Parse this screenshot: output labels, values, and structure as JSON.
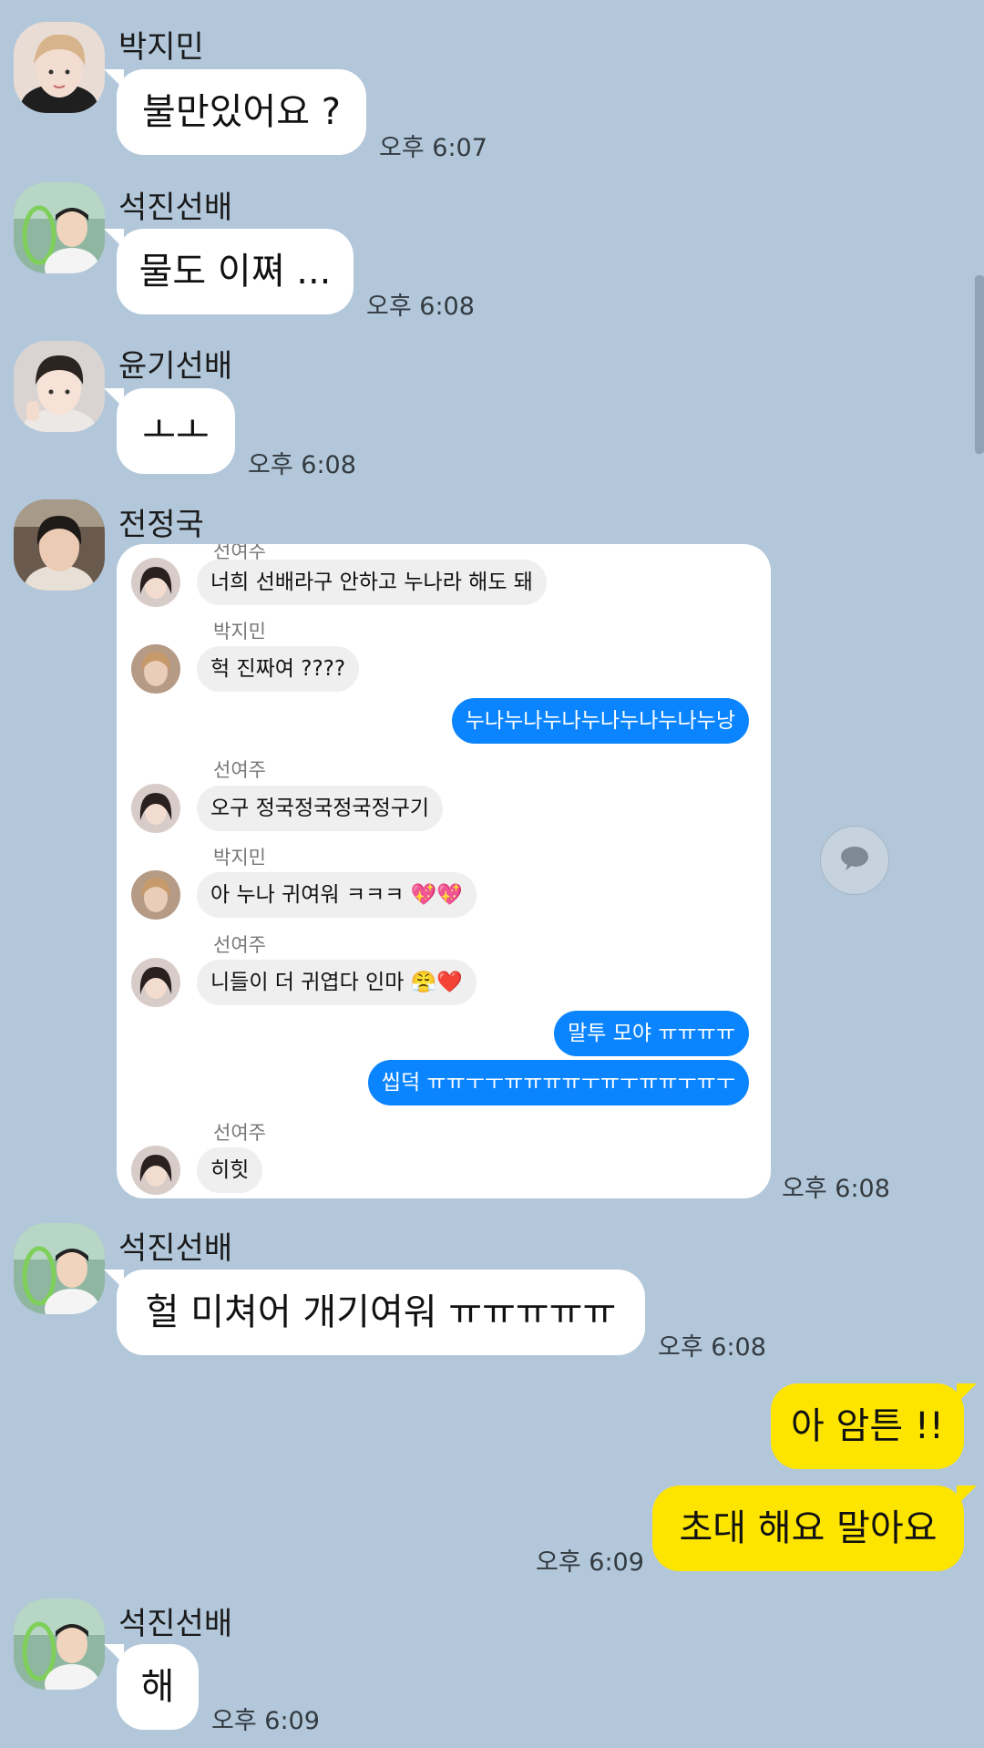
{
  "messages": [
    {
      "sender": "박지민",
      "text": "불만있어요 ?",
      "time": "오후 6:07"
    },
    {
      "sender": "석진선배",
      "text": "물도 이쪄 ...",
      "time": "오후 6:08"
    },
    {
      "sender": "윤기선배",
      "text": "ㅗㅗ",
      "time": "오후 6:08"
    },
    {
      "sender": "전정국",
      "time": "오후 6:08"
    },
    {
      "sender": "석진선배",
      "text": "헐 미쳐어 개기여워 ㅠㅠㅠㅠㅠ",
      "time": "오후 6:08"
    },
    {
      "text": "아 암튼 !!"
    },
    {
      "text": "초대 해요 말아요",
      "time": "오후 6:09"
    },
    {
      "sender": "석진선배",
      "text": "해",
      "time": "오후 6:09"
    }
  ],
  "embedded_screenshot": {
    "cut_name": "선여주",
    "items": [
      {
        "text": "너희 선배라구 안하고 누나라 해도 돼"
      },
      {
        "name": "박지민",
        "text": "헉 진짜여 ????"
      },
      {
        "text": "누나누나누나누나누나누나누낭"
      },
      {
        "name": "선여주",
        "text": "오구 정국정국정국정구기"
      },
      {
        "name": "박지민",
        "text": "아 누나 귀여워 ㅋㅋㅋ 💖💖"
      },
      {
        "name": "선여주",
        "text": "니들이 더 귀엽다 인마 😤❤️"
      },
      {
        "text": "말투 모야 ㅠㅠㅠㅠ"
      },
      {
        "text": "씹덕 ㅠㅠㅜㅜㅠㅠㅠㅠㅜㅠㅜㅠㅠㅜㅠㅜ"
      },
      {
        "name": "선여주",
        "text": "히힛"
      }
    ]
  },
  "icons": {
    "chat_fab": "speech-bubble-icon",
    "scrollbar": "scrollbar"
  },
  "colors": {
    "background": "#b2c7da",
    "incoming_bubble": "#ffffff",
    "outgoing_bubble": "#fee500",
    "embedded_outgoing": "#0a84ff"
  }
}
